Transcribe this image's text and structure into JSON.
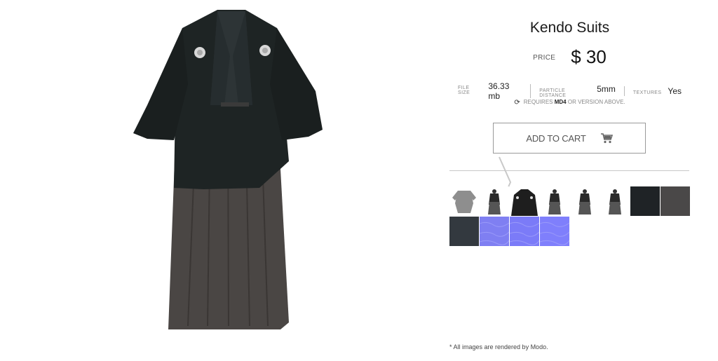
{
  "product": {
    "title": "Kendo Suits",
    "price_label": "PRICE",
    "price": "$ 30"
  },
  "specs": [
    {
      "label": "FILE SIZE",
      "value": "36.33 mb"
    },
    {
      "label": "PARTICLE DISTANCE",
      "value": "5mm"
    },
    {
      "label": "TEXTURES",
      "value": "Yes"
    }
  ],
  "requirement": {
    "prefix": "REQUIRES",
    "app": "MD4",
    "suffix": "OR VERSION ABOVE."
  },
  "cart": {
    "label": "ADD TO CART",
    "icon": "cart-icon"
  },
  "gallery": {
    "selected_index": 0,
    "thumbnails": [
      {
        "name": "thumb-grey-robe",
        "kind": "garment",
        "color": "#8e8e8e"
      },
      {
        "name": "thumb-back-view",
        "kind": "figure",
        "color": "#2a2a2a"
      },
      {
        "name": "thumb-closeup",
        "kind": "closeup",
        "color": "#1e1e1e"
      },
      {
        "name": "thumb-figure-side",
        "kind": "figure",
        "color": "#2a2a2a"
      },
      {
        "name": "thumb-figure-sword",
        "kind": "figure",
        "color": "#2a2a2a"
      },
      {
        "name": "thumb-figure-stance",
        "kind": "figure",
        "color": "#2a2a2a"
      },
      {
        "name": "thumb-texture-black",
        "kind": "swatch",
        "color": "#1f2326"
      },
      {
        "name": "thumb-texture-grey",
        "kind": "swatch",
        "color": "#4a4848"
      },
      {
        "name": "thumb-texture-slate",
        "kind": "swatch",
        "color": "#33393f"
      },
      {
        "name": "thumb-normal-map-1",
        "kind": "swatch",
        "color": "#7f7ff2"
      },
      {
        "name": "thumb-normal-map-2",
        "kind": "swatch",
        "color": "#7b7bf8"
      },
      {
        "name": "thumb-normal-map-3",
        "kind": "swatch",
        "color": "#7f7ffc"
      }
    ]
  },
  "footnote": "* All images are rendered by Modo.",
  "colors": {
    "accent_selected": "#f2c200",
    "jacket": "#1e2424",
    "hakama": "#4a4644"
  }
}
